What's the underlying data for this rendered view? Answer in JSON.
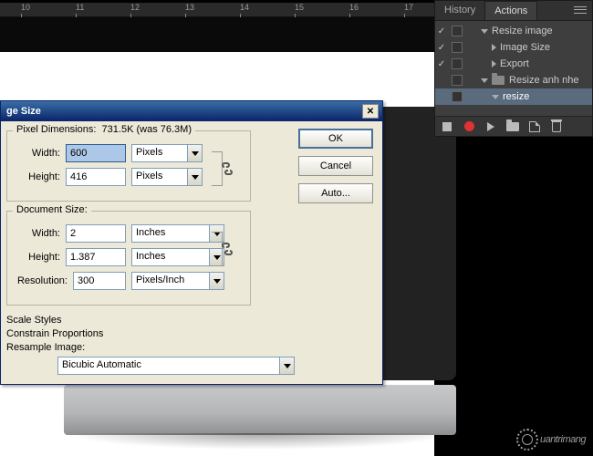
{
  "ruler": {
    "ticks": [
      "10",
      "11",
      "12",
      "13",
      "14",
      "15",
      "16",
      "17"
    ]
  },
  "dialog": {
    "title": "ge Size",
    "pixel_dimensions_label": "Pixel Dimensions:",
    "pixel_dimensions_value": "731.5K (was 76.3M)",
    "width_label": "Width:",
    "height_label": "Height:",
    "resolution_label": "Resolution:",
    "px_width": "600",
    "px_height": "416",
    "px_unit": "Pixels",
    "doc_label": "Document Size:",
    "doc_width": "2",
    "doc_height": "1.387",
    "doc_unit": "Inches",
    "res_value": "300",
    "res_unit": "Pixels/Inch",
    "scale_styles_label": "Scale Styles",
    "constrain_label": "Constrain Proportions",
    "resample_label": "Resample Image:",
    "resample_method": "Bicubic Automatic",
    "ok_label": "OK",
    "cancel_label": "Cancel",
    "auto_label": "Auto..."
  },
  "panel": {
    "history_tab": "History",
    "actions_tab": "Actions",
    "items": [
      {
        "name": "Resize image",
        "kind": "set",
        "checked": true,
        "level": 0
      },
      {
        "name": "Image Size",
        "kind": "step",
        "checked": true,
        "level": 1
      },
      {
        "name": "Export",
        "kind": "step",
        "checked": true,
        "level": 1
      },
      {
        "name": "Resize anh nhe",
        "kind": "set",
        "checked": false,
        "level": 0
      },
      {
        "name": "resize",
        "kind": "action",
        "checked": false,
        "level": 1,
        "selected": true
      }
    ]
  },
  "watermark": "uantrimang"
}
